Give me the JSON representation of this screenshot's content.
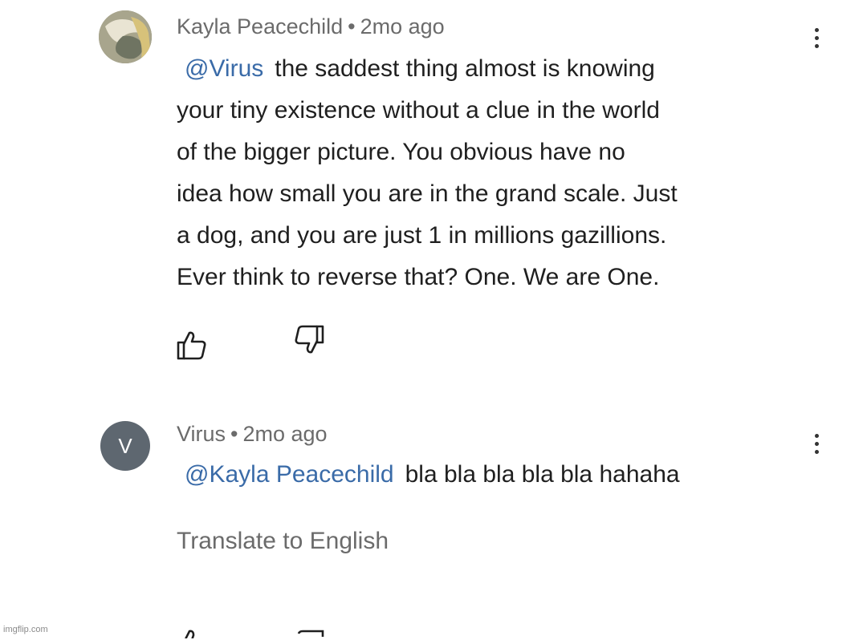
{
  "comments": [
    {
      "author": "Kayla Peacechild",
      "separator": "•",
      "time": "2mo ago",
      "mention": "@Virus",
      "lines": [
        "the saddest thing almost is knowing",
        "your tiny existence without a clue in the world",
        "of the bigger picture. You obvious have no",
        "idea how small you are in the grand scale. Just",
        "a dog, and you are just 1 in millions gazillions.",
        "Ever think to reverse that? One. We are One."
      ]
    },
    {
      "author": "Virus",
      "avatar_letter": "V",
      "separator": "•",
      "time": "2mo ago",
      "mention": "@Kayla Peacechild",
      "text": "bla bla bla bla bla hahaha",
      "translate_label": "Translate to English"
    }
  ],
  "watermark": "imgflip.com",
  "icons": {
    "like": "thumbs-up-icon",
    "dislike": "thumbs-down-icon",
    "menu": "more-vertical-icon"
  },
  "colors": {
    "mention": "#3a6ba8",
    "meta": "#6b6b6b",
    "avatar_v": "#5e6770"
  }
}
